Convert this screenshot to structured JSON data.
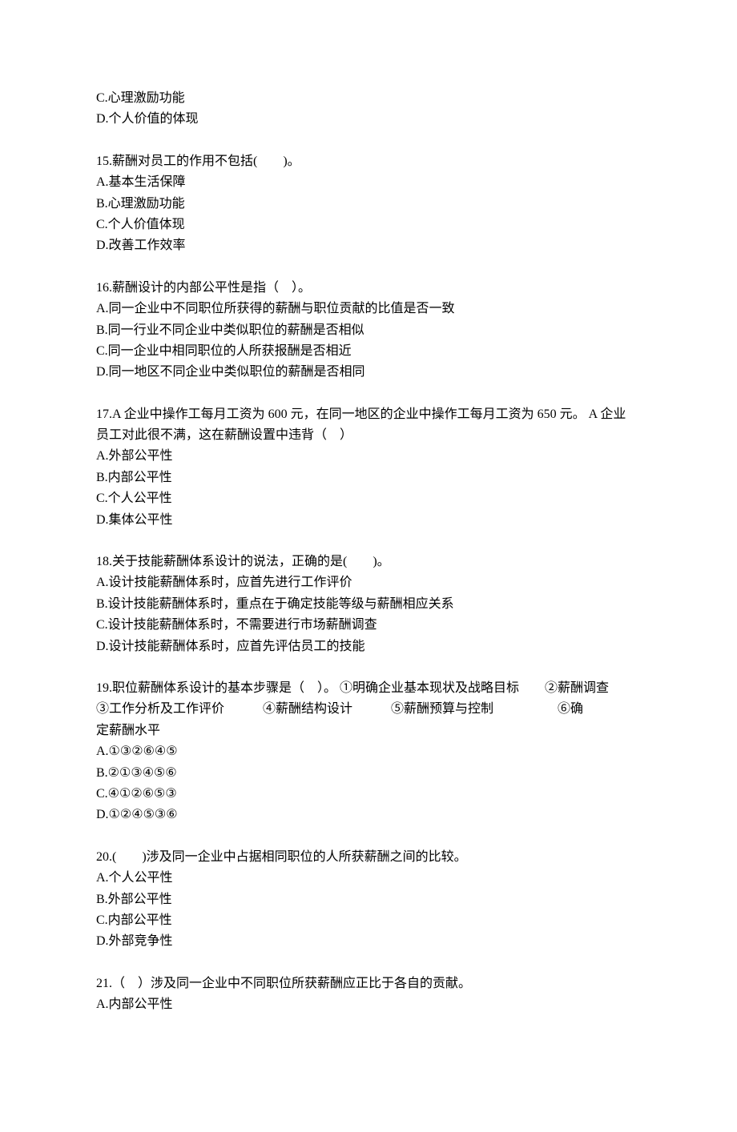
{
  "orphanOptions": [
    "C.心理激励功能",
    "D.个人价值的体现"
  ],
  "questions": [
    {
      "numLabel": "15.",
      "stemLines": [
        "薪酬对员工的作用不包括(　　)。"
      ],
      "options": [
        "A.基本生活保障",
        "B.心理激励功能",
        "C.个人价值体现",
        "D.改善工作效率"
      ]
    },
    {
      "numLabel": "16.",
      "stemLines": [
        "薪酬设计的内部公平性是指（　）。"
      ],
      "options": [
        "A.同一企业中不同职位所获得的薪酬与职位贡献的比值是否一致",
        "B.同一行业不同企业中类似职位的薪酬是否相似",
        "C.同一企业中相同职位的人所获报酬是否相近",
        "D.同一地区不同企业中类似职位的薪酬是否相同"
      ]
    },
    {
      "numLabel": "17.",
      "stemLines": [
        "A 企业中操作工每月工资为 600 元，在同一地区的企业中操作工每月工资为 650 元。 A 企业",
        "员工对此很不满，这在薪酬设置中违背（　）"
      ],
      "options": [
        "A.外部公平性",
        "B.内部公平性",
        "C.个人公平性",
        "D.集体公平性"
      ]
    },
    {
      "numLabel": "18.",
      "stemLines": [
        "关于技能薪酬体系设计的说法，正确的是(　　)。"
      ],
      "options": [
        "A.设计技能薪酬体系时，应首先进行工作评价",
        "B.设计技能薪酬体系时，重点在于确定技能等级与薪酬相应关系",
        "C.设计技能薪酬体系时，不需要进行市场薪酬调查",
        "D.设计技能薪酬体系时，应首先评估员工的技能"
      ]
    },
    {
      "numLabel": "19.",
      "stemLines": [
        "职位薪酬体系设计的基本步骤是（　）。 ①明确企业基本现状及战略目标　　②薪酬调查",
        "③工作分析及工作评价　　　④薪酬结构设计　　　⑤薪酬预算与控制　　　　　⑥确",
        "定薪酬水平"
      ],
      "options": [
        "A.①③②⑥④⑤",
        "B.②①③④⑤⑥",
        "C.④①②⑥⑤③",
        "D.①②④⑤③⑥"
      ]
    },
    {
      "numLabel": "20.",
      "stemLines": [
        "(　　)涉及同一企业中占据相同职位的人所获薪酬之间的比较。"
      ],
      "options": [
        "A.个人公平性",
        "B.外部公平性",
        "C.内部公平性",
        "D.外部竞争性"
      ]
    },
    {
      "numLabel": "21.",
      "stemLines": [
        "（　）涉及同一企业中不同职位所获薪酬应正比于各自的贡献。"
      ],
      "options": [
        "A.内部公平性"
      ]
    }
  ]
}
